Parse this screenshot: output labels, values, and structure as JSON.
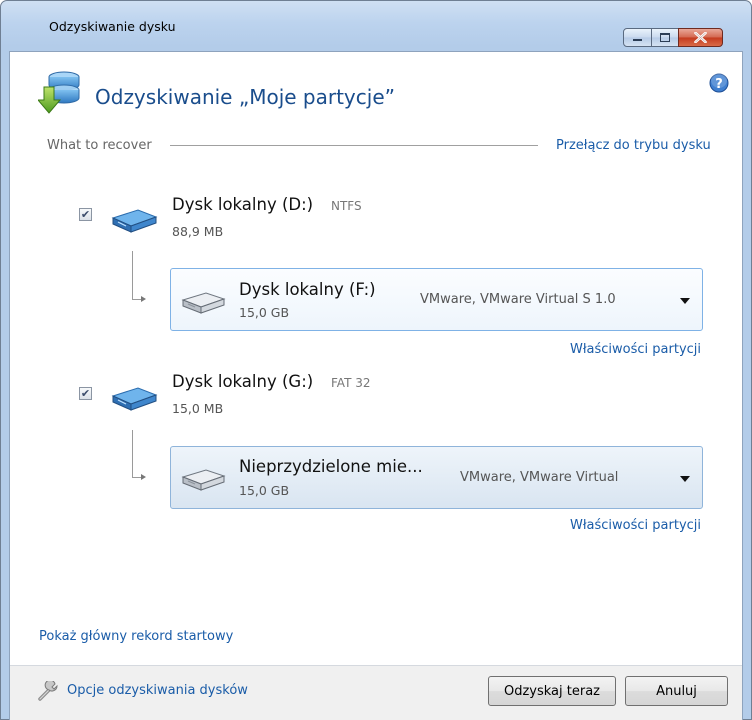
{
  "window": {
    "title": "Odzyskiwanie dysku",
    "controls": {
      "minimize": "minimize",
      "maximize": "maximize",
      "close": "close"
    }
  },
  "header": {
    "title": "Odzyskiwanie „Moje partycje”",
    "icon": "disk-recovery-icon",
    "help_icon": "help-icon"
  },
  "section": {
    "label": "What to recover",
    "switch_link": "Przełącz do trybu dysku"
  },
  "partitions": [
    {
      "name": "Dysk lokalny (D:)",
      "fs": "NTFS",
      "size": "88,9 MB",
      "checked": true,
      "target": {
        "name": "Dysk lokalny (F:)",
        "size": "15,0 GB",
        "device": "VMware, VMware Virtual S 1.0"
      },
      "props_link": "Właściwości partycji"
    },
    {
      "name": "Dysk lokalny (G:)",
      "fs": "FAT 32",
      "size": "15,0 MB",
      "checked": true,
      "target": {
        "name": "Nieprzydzielone mie...",
        "size": "15,0 GB",
        "device": "VMware, VMware Virtual"
      },
      "props_link": "Właściwości partycji"
    }
  ],
  "mbr_link": "Pokaż główny rekord startowy",
  "footer": {
    "options_link": "Opcje odzyskiwania dysków",
    "recover_button": "Odzyskaj teraz",
    "cancel_button": "Anuluj"
  },
  "colors": {
    "accent": "#1a4d8c",
    "link": "#1a5ca8",
    "window_frame": "#bcd3ee",
    "close_button": "#c43a1e"
  }
}
